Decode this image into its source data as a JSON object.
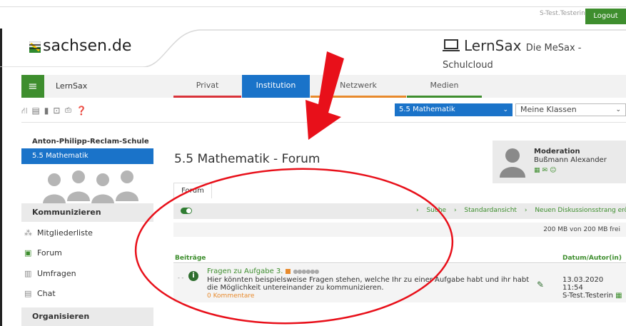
{
  "topbar": {
    "user": "S-Test.Testerin",
    "logout_label": "Logout"
  },
  "brand": {
    "left_logo": "sachsen.de",
    "right_logo": "LernSax",
    "right_sub": "Die MeSax - Schulcloud"
  },
  "nav": {
    "menu_label": "LernSax",
    "tabs": [
      {
        "label": "Privat"
      },
      {
        "label": "Institution"
      },
      {
        "label": "Netzwerk"
      },
      {
        "label": "Medien"
      }
    ],
    "toolbar_icons": [
      "sitemap-icon",
      "notes-icon",
      "bookmark-icon",
      "login-icon",
      "print-icon",
      "help-icon"
    ],
    "course_select": "5.5 Mathematik",
    "class_select": "Meine Klassen"
  },
  "sidebar": {
    "school": "Anton-Philipp-Reclam-Schule",
    "course": "5.5 Mathematik",
    "section1": "Kommunizieren",
    "items": [
      {
        "label": "Mitgliederliste",
        "icon": "members-icon"
      },
      {
        "label": "Forum",
        "icon": "forum-icon"
      },
      {
        "label": "Umfragen",
        "icon": "poll-icon"
      },
      {
        "label": "Chat",
        "icon": "chat-icon"
      }
    ],
    "section2": "Organisieren"
  },
  "main": {
    "title": "5.5 Mathematik - Forum",
    "moderation_label": "Moderation",
    "moderator": "Bußmann Alexander",
    "tab_label": "Forum",
    "links": [
      "Suche",
      "Standardansicht",
      "Neuen Diskussionsstrang eröffnen"
    ],
    "quota": "200 MB von 200 MB frei",
    "col_posts": "Beiträge",
    "col_date": "Datum/Autor(in)",
    "post": {
      "title": "Fragen zu Aufgabe 3.",
      "body": "Hier könnten beispielsweise Fragen stehen, welche Ihr zu einer Aufgabe habt und ihr habt die Möglichkeit untereinander zu kommunizieren.",
      "comments": "0 Kommentare",
      "date": "13.03.2020 11:54",
      "author": "S-Test.Testerin"
    }
  },
  "annotation_colors": {
    "arrow": "#e8101a",
    "ellipse": "#e8101a"
  }
}
